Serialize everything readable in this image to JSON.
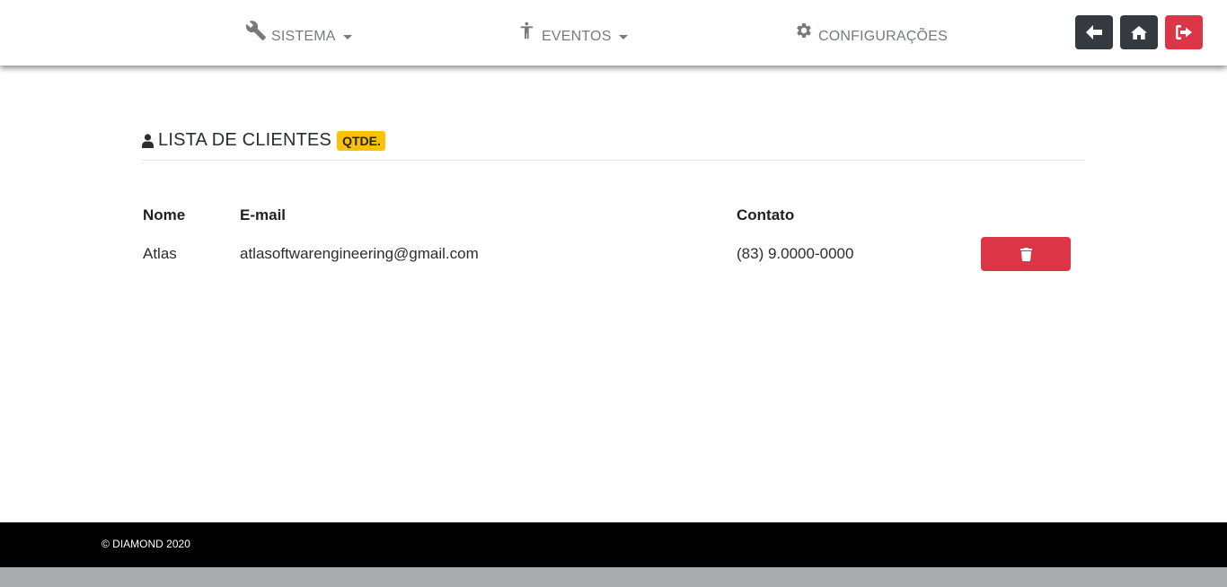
{
  "nav": {
    "sistema": {
      "label": "SISTEMA",
      "icon": "wrench-icon"
    },
    "eventos": {
      "label": "EVENTOS",
      "icon": "accessibility-icon"
    },
    "config": {
      "label": "CONFIGURAÇÕES",
      "icon": "gear-icon"
    },
    "buttons": [
      {
        "name": "back-button",
        "icon": "arrow-left-icon",
        "color": "#343a40"
      },
      {
        "name": "home-button",
        "icon": "home-icon",
        "color": "#343a40"
      },
      {
        "name": "logout-button",
        "icon": "sign-out-icon",
        "color": "#dc3545"
      }
    ]
  },
  "heading": {
    "icon": "user-icon",
    "title": "LISTA DE CLIENTES",
    "badge": "QTDE."
  },
  "table": {
    "headers": [
      "Nome",
      "E-mail",
      "Contato"
    ],
    "rows": [
      {
        "nome": "Atlas",
        "email": "atlasoftwarengineering@gmail.com",
        "contato": "(83) 9.0000-0000",
        "action_icon": "trash-icon"
      }
    ]
  },
  "footer": {
    "copyright": "© DIAMOND 2020"
  },
  "colors": {
    "danger": "#dc3545",
    "dark": "#343a40",
    "warning": "#ffc107",
    "footer": "#000000"
  }
}
